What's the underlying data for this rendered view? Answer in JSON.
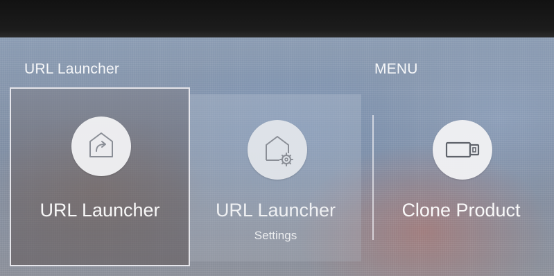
{
  "header": {
    "left_title": "URL Launcher",
    "right_title": "MENU"
  },
  "tiles": [
    {
      "label": "URL Launcher",
      "sublabel": "",
      "icon": "house-arrow-icon",
      "selected": true
    },
    {
      "label": "URL Launcher",
      "sublabel": "Settings",
      "icon": "house-gear-icon",
      "selected": false
    },
    {
      "label": "Clone Product",
      "sublabel": "",
      "icon": "usb-drive-icon",
      "selected": false
    }
  ],
  "colors": {
    "icon_stroke": "#8a8e96",
    "icon_bg": "#f2f2f4",
    "text": "#ffffff"
  }
}
